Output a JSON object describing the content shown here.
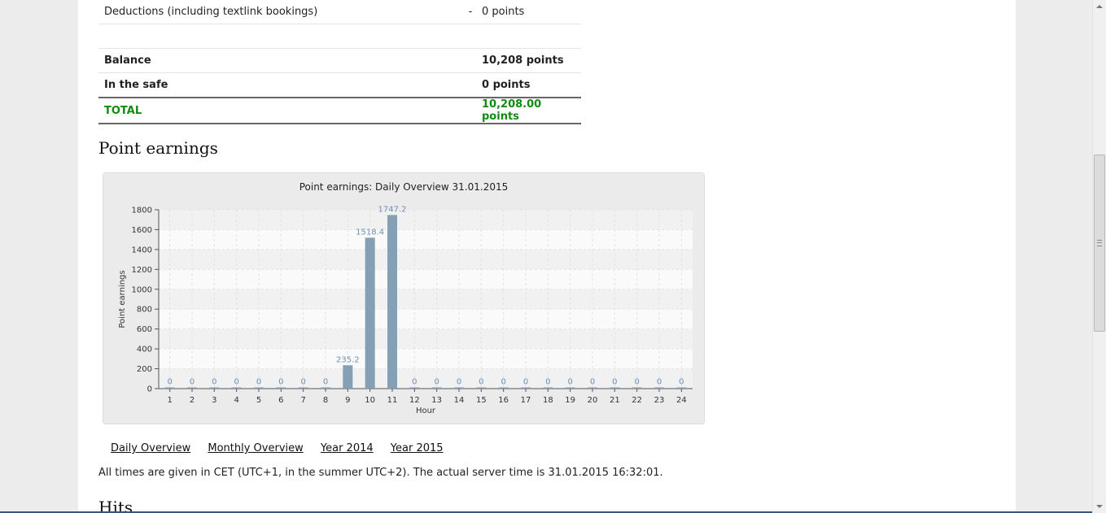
{
  "summary": {
    "deductions": {
      "label": "Deductions (including textlink bookings)",
      "sign": "-",
      "value": "0 points"
    },
    "balance": {
      "label": "Balance",
      "value": "10,208 points"
    },
    "safe": {
      "label": "In the safe",
      "value": "0 points"
    },
    "total": {
      "label": "TOTAL",
      "value": "10,208.00 points"
    }
  },
  "section_title": "Point earnings",
  "chart_data": {
    "type": "bar",
    "title": "Point earnings: Daily Overview 31.01.2015",
    "xlabel": "Hour",
    "ylabel": "Point earnings",
    "ylim": [
      0,
      1800
    ],
    "yticks": [
      0,
      200,
      400,
      600,
      800,
      1000,
      1200,
      1400,
      1600,
      1800
    ],
    "grid": true,
    "categories": [
      "1",
      "2",
      "3",
      "4",
      "5",
      "6",
      "7",
      "8",
      "9",
      "10",
      "11",
      "12",
      "13",
      "14",
      "15",
      "16",
      "17",
      "18",
      "19",
      "20",
      "21",
      "22",
      "23",
      "24"
    ],
    "values": [
      0,
      0,
      0,
      0,
      0,
      0,
      0,
      0,
      235.2,
      1518.4,
      1747.2,
      0,
      0,
      0,
      0,
      0,
      0,
      0,
      0,
      0,
      0,
      0,
      0,
      0
    ],
    "bar_color": "#859fb4",
    "label_color": "#6f8fb0"
  },
  "links": [
    {
      "label": "Daily Overview"
    },
    {
      "label": "Monthly Overview"
    },
    {
      "label": "Year 2014"
    },
    {
      "label": "Year 2015"
    }
  ],
  "note": "All times are given in CET (UTC+1, in the summer UTC+2). The actual server time is 31.01.2015 16:32:01.",
  "next_section_title": "Hits"
}
